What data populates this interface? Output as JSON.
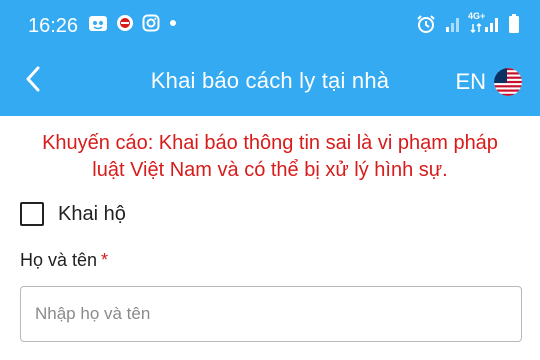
{
  "status_bar": {
    "time": "16:26",
    "network_label": "4G+",
    "icons_left": [
      "app-notification-icon",
      "game-icon",
      "instagram-icon",
      "dot-icon"
    ],
    "icons_right": [
      "alarm-icon",
      "signal-icon",
      "signal-4g-icon",
      "battery-icon"
    ]
  },
  "header": {
    "title": "Khai báo cách ly tại nhà",
    "language": "EN",
    "background": "#34aaf2"
  },
  "warning": {
    "text": "Khuyến cáo: Khai báo thông tin sai là vi phạm pháp luật Việt Nam và có thể bị xử lý hình sự.",
    "color": "#d81b1b"
  },
  "form": {
    "declare_for_others": {
      "label": "Khai hộ",
      "checked": false
    },
    "full_name": {
      "label": "Họ và tên",
      "required_mark": "*",
      "value": "",
      "placeholder": "Nhập họ và tên"
    }
  }
}
